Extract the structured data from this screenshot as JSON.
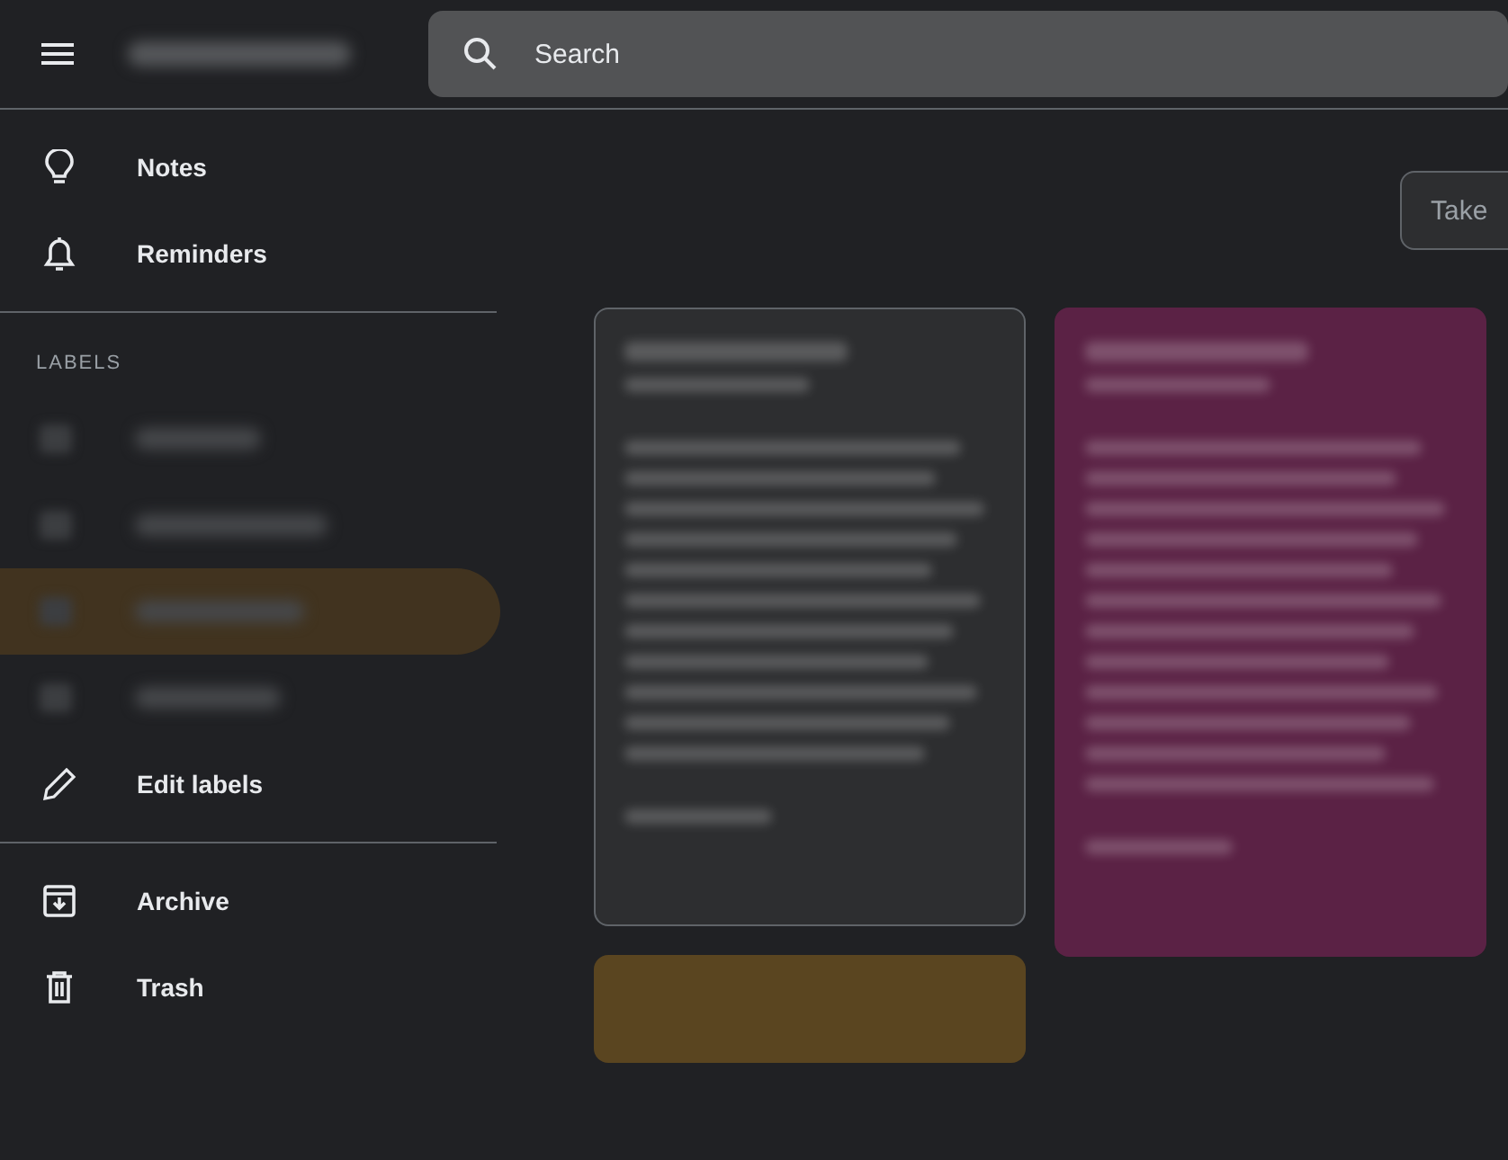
{
  "search": {
    "placeholder": "Search"
  },
  "nav_top": [
    {
      "label": "Notes"
    },
    {
      "label": "Reminders"
    }
  ],
  "labels_heading": "LABELS",
  "labels": [
    {
      "selected": false
    },
    {
      "selected": false
    },
    {
      "selected": true
    },
    {
      "selected": false
    }
  ],
  "edit_labels": {
    "label": "Edit labels"
  },
  "nav_bottom": [
    {
      "label": "Archive"
    },
    {
      "label": "Trash"
    }
  ],
  "take_note": {
    "placeholder": "Take"
  },
  "columns": [
    [
      {
        "color": "#2d2e30",
        "outlined": true,
        "blurred_text": true
      },
      {
        "color": "#5a4520",
        "outlined": false,
        "blurred_text": false
      }
    ],
    [
      {
        "color": "#5b2245",
        "outlined": false,
        "blurred_text": true
      }
    ]
  ]
}
